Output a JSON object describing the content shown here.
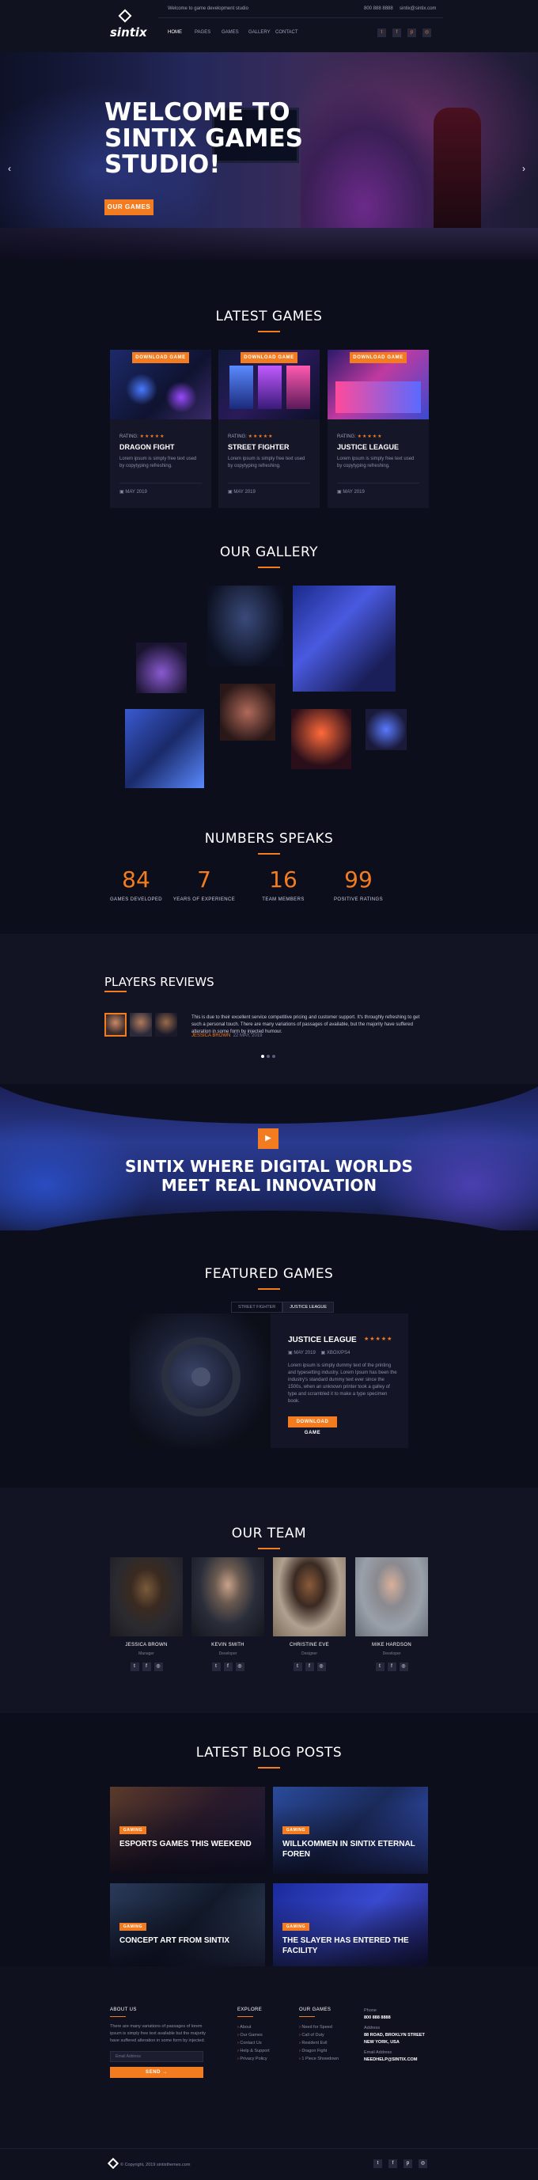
{
  "header": {
    "logo_text": "sintix",
    "top_message": "Welcome to game development studio",
    "phone": "800 888 8888",
    "email": "sintix@sintix.com",
    "nav": [
      "HOME",
      "PAGES",
      "GAMES",
      "GALLERY",
      "CONTACT"
    ],
    "social_icons": [
      "twitter-icon",
      "facebook-icon",
      "pinterest-icon",
      "instagram-icon"
    ]
  },
  "hero": {
    "title": "WELCOME TO SINTIX GAMES STUDIO!",
    "button": "OUR GAMES",
    "prev": "‹",
    "next": "›"
  },
  "latest_games": {
    "title": "LATEST GAMES",
    "cards": [
      {
        "tag": "DOWNLOAD GAME",
        "rating_label": "RATING:",
        "stars": "★★★★★",
        "name": "DRAGON FIGHT",
        "desc": "Lorem ipsum is simply free text used by copytyping refreshing.",
        "date": "MAY 2019"
      },
      {
        "tag": "DOWNLOAD GAME",
        "rating_label": "RATING:",
        "stars": "★★★★★",
        "name": "STREET FIGHTER",
        "desc": "Lorem ipsum is simply free text used by copytyping refreshing.",
        "date": "MAY 2019"
      },
      {
        "tag": "DOWNLOAD GAME",
        "rating_label": "RATING:",
        "stars": "★★★★★",
        "name": "JUSTICE LEAGUE",
        "desc": "Lorem ipsum is simply free text used by copytyping refreshing.",
        "date": "MAY 2019"
      }
    ]
  },
  "gallery": {
    "title": "OUR GALLERY"
  },
  "numbers": {
    "title": "NUMBERS SPEAKS",
    "items": [
      {
        "value": "84",
        "label": "GAMES DEVELOPED"
      },
      {
        "value": "7",
        "label": "YEARS OF EXPERIENCE"
      },
      {
        "value": "16",
        "label": "TEAM MEMBERS"
      },
      {
        "value": "99",
        "label": "POSITIVE RATINGS"
      }
    ]
  },
  "reviews": {
    "title": "PLAYERS REVIEWS",
    "quote": "This is due to their excellent service competitive pricing and customer support. It's throughly refreshing to get such a personal touch. There are many variations of passages of available, but the majority have suffered alteration in some form by injected humour.",
    "author": "JESSICA BROWN",
    "date": "22 MAY, 2019"
  },
  "banner": {
    "text": "SINTIX WHERE DIGITAL WORLDS MEET REAL INNOVATION",
    "play": "▶"
  },
  "featured": {
    "title": "FEATURED GAMES",
    "tabs": [
      "STREET FIGHTER",
      "JUSTICE LEAGUE"
    ],
    "game": {
      "name": "JUSTICE LEAGUE",
      "stars": "★★★★★",
      "date": "MAY 2019",
      "platform": "XBOX/PS4",
      "desc": "Lorem ipsum is simply dummy text of the printing and typesetting industry. Lorem Ipsum has been the industry's standard dummy text ever since the 1500s, when an unknown printer took a galley of type and scrambled it to make a type specimen book.",
      "button": "DOWNLOAD GAME"
    }
  },
  "team": {
    "title": "OUR TEAM",
    "members": [
      {
        "name": "JESSICA BROWN",
        "role": "Manager"
      },
      {
        "name": "KEVIN SMITH",
        "role": "Developer"
      },
      {
        "name": "CHRISTINE EVE",
        "role": "Designer"
      },
      {
        "name": "MIKE HARDSON",
        "role": "Developer"
      }
    ]
  },
  "blog": {
    "title": "LATEST BLOG POSTS",
    "posts": [
      {
        "cat": "GAMING",
        "title": "ESPORTS GAMES THIS WEEKEND"
      },
      {
        "cat": "GAMING",
        "title": "WILLKOMMEN IN SINTIX ETERNAL FOREN"
      },
      {
        "cat": "GAMING",
        "title": "CONCEPT ART FROM SINTIX"
      },
      {
        "cat": "GAMING",
        "title": "THE SLAYER HAS ENTERED THE FACILITY"
      }
    ]
  },
  "footer": {
    "about_title": "ABOUT US",
    "about_text": "There are many variations of passages of lorem ipsum is simply free text available but the majority have suffered alteration in some form by injected.",
    "email_placeholder": "Email Address",
    "subscribe": "SEND →",
    "explore_title": "EXPLORE",
    "explore": [
      "About",
      "Our Games",
      "Contact Us",
      "Help & Support",
      "Privacy Policy"
    ],
    "games_title": "OUR GAMES",
    "games": [
      "Need for Speed",
      "Call of Duty",
      "Resident Evil",
      "Dragon Fight",
      "1 Piece Showdown"
    ],
    "contact": {
      "phone_label": "Phone",
      "phone": "800 888 8888",
      "address_label": "Address",
      "address": "88 ROAD, BROKLYN STREET NEW YORK, USA",
      "email_label": "Email Address",
      "email": "NEEDHELP@SINTIX.COM"
    },
    "copyright": "© Copyright, 2019 sintixthemes.com"
  }
}
